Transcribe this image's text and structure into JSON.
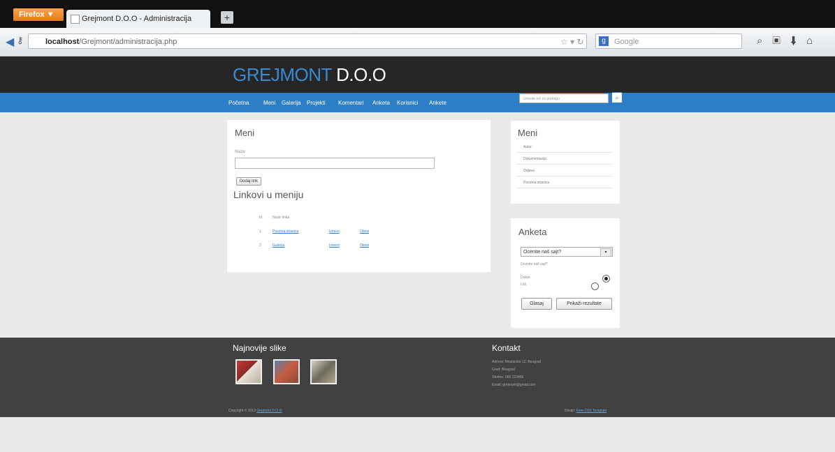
{
  "browser": {
    "menu_button": "Firefox ▼",
    "tab_title": "Grejmont D.O.O - Administracija",
    "new_tab": "+",
    "url_host": "localhost",
    "url_path": "/Grejmont/administracija.php",
    "search_engine": "Google"
  },
  "site": {
    "logo_blue": "GREJMONT",
    "logo_white": " D.O.O",
    "menu": [
      "Početna",
      "Meni",
      "Galerija",
      "Projekti",
      "Komentari",
      "Anketa",
      "Korisnici",
      "Ankete"
    ],
    "search_placeholder": "Unesite reč za pretragu"
  },
  "main": {
    "title": "Meni",
    "field_label": "Naziv",
    "add_button": "Dodaj link",
    "links_title": "Linkovi u meniju",
    "table_header": [
      "Id",
      "Naziv linka"
    ],
    "rows": [
      {
        "id": "1",
        "name": "Pocetna stranica",
        "edit": "Izmeni",
        "delete": "Obrisi"
      },
      {
        "id": "2",
        "name": "Galerija",
        "edit": "Izmeni",
        "delete": "Obrisi"
      }
    ]
  },
  "side_menu": {
    "title": "Meni",
    "items": [
      "Autor",
      "Dokumentacija",
      "Odjava",
      "Pocetna stranica"
    ]
  },
  "poll": {
    "title": "Anketa",
    "select_value": "Ocenite naš sajt?",
    "question": "Ocenite naš sajt?",
    "options": [
      "Dobar",
      "Loš"
    ],
    "vote_button": "Glasaj",
    "results_button": "Prikaži rezultate"
  },
  "footer": {
    "latest_title": "Najnovije slike",
    "contact_title": "Kontakt",
    "contact_lines": [
      "Adresa: Mostarsko 12, Beograd",
      "Grad: Beograd",
      "Telefon: 065 123456",
      "Email: grejmont@gmail.com"
    ],
    "copyright_prefix": "Copyright © 2013 ",
    "copyright_link": "Grejmont D.O.O",
    "design_prefix": "Dizajn: ",
    "design_link": "Free CSS Template"
  }
}
